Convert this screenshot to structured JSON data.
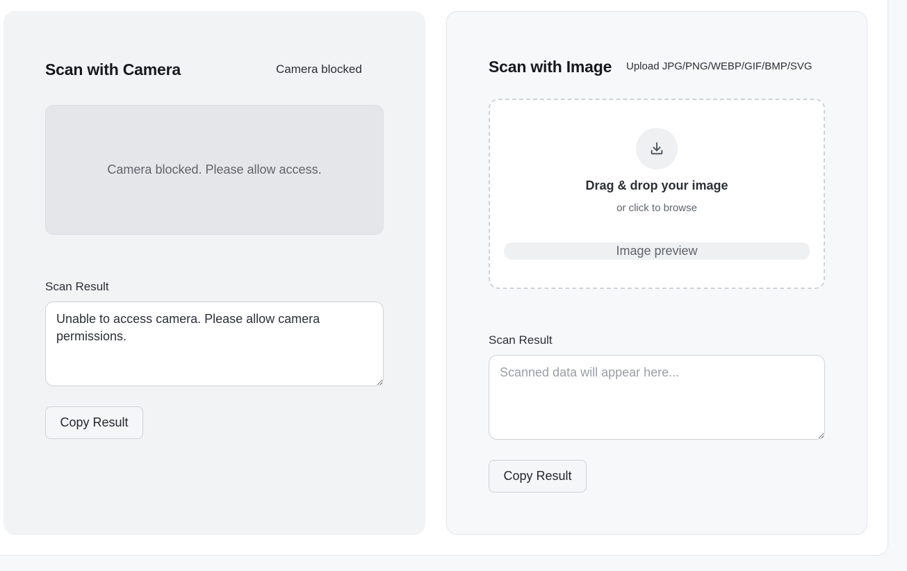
{
  "camera_panel": {
    "title": "Scan with Camera",
    "status": "Camera blocked",
    "camera_message": "Camera blocked. Please allow access.",
    "result_label": "Scan Result",
    "result_value": "Unable to access camera. Please allow camera permissions.",
    "copy_label": "Copy Result"
  },
  "image_panel": {
    "title": "Scan with Image",
    "upload_hint": "Upload JPG/PNG/WEBP/GIF/BMP/SVG",
    "upload_icon": "download-icon",
    "drop_title": "Drag & drop your image",
    "drop_subtitle": "or click to browse",
    "preview_label": "Image preview",
    "result_label": "Scan Result",
    "result_placeholder": "Scanned data will appear here...",
    "copy_label": "Copy Result"
  }
}
